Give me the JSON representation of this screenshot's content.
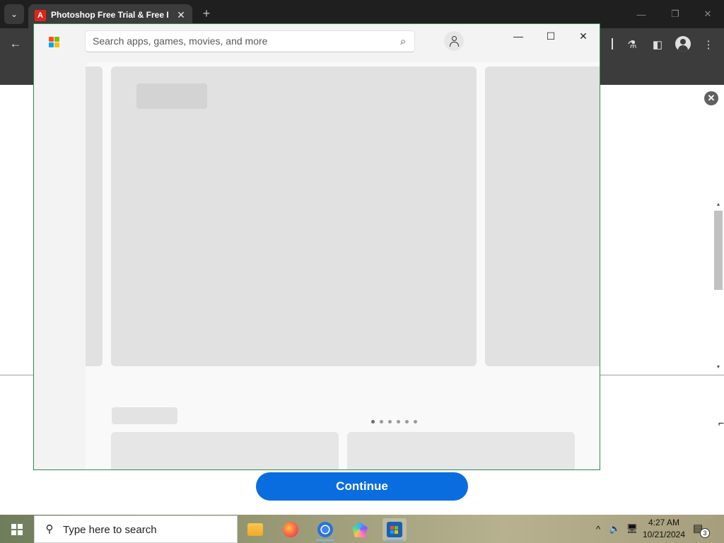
{
  "browser": {
    "tab_title": "Photoshop Free Trial & Free Do",
    "tab_favicon_letter": "A",
    "new_tab_label": "+",
    "close_tab_label": "✕",
    "tab_list_label": "⌄",
    "window_controls": {
      "minimize": "—",
      "maximize": "❐",
      "close": "✕"
    },
    "toolbar": {
      "back_label": "←",
      "labs_label": "⚗",
      "sidepanel_label": "◧",
      "menu_label": "⋮"
    }
  },
  "store": {
    "search_placeholder": "Search apps, games, movies, and more",
    "search_icon": "⌕",
    "window_controls": {
      "minimize": "—",
      "maximize": "☐",
      "close": "✕"
    },
    "carousel_dots": 6,
    "active_dot": 0
  },
  "page": {
    "close_label": "✕",
    "continue_label": "Continue",
    "scroll_up": "▲",
    "scroll_down": "▼",
    "cursor": "⌐"
  },
  "taskbar": {
    "search_text": "Type here to search",
    "search_icon": "⚲",
    "time": "4:27 AM",
    "date": "10/21/2024",
    "notification_count": "3",
    "tray": {
      "chevron": "^",
      "volume": "🔈",
      "network": "🖥"
    }
  },
  "colors": {
    "accent": "#0a6ddf",
    "store_border": "#2e8b57",
    "adobe_red": "#e1251b",
    "placeholder_gray": "#e1e1e1"
  }
}
